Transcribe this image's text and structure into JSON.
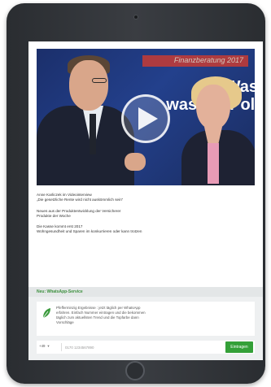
{
  "video": {
    "banner_text": "Finanzberatung 2017",
    "background_line_1": "Was",
    "background_line_2": "was die Politi"
  },
  "articles": [
    {
      "title": "Anne Karliczek im Videointerview",
      "subtitle": "„Die gesetzliche Rente wird nicht auskömmlich sein“"
    },
    {
      "title": "Neues aus der Produktentwicklung der Versicherer",
      "subtitle": "Produkte der Woche"
    },
    {
      "title": "Die Kasse kommt erst 2017",
      "subtitle": "Wohngesundheit und Sparen im konkurrieren oder kann trotzen"
    }
  ],
  "whatsapp": {
    "header": "Neu: WhatsApp-Service",
    "message_lines": [
      "Pfefferminzig Ergebnisse : jetzt täglich per WhatsApp",
      "erfahren. Einfach Nummer eintragen und die bekommen",
      "täglich zum aktuellsten Trend und die Topfarbe dann",
      "Vorschläge"
    ],
    "country_code": "+49",
    "phone_placeholder": "0170 1234567890",
    "submit_label": "Eintragen"
  }
}
